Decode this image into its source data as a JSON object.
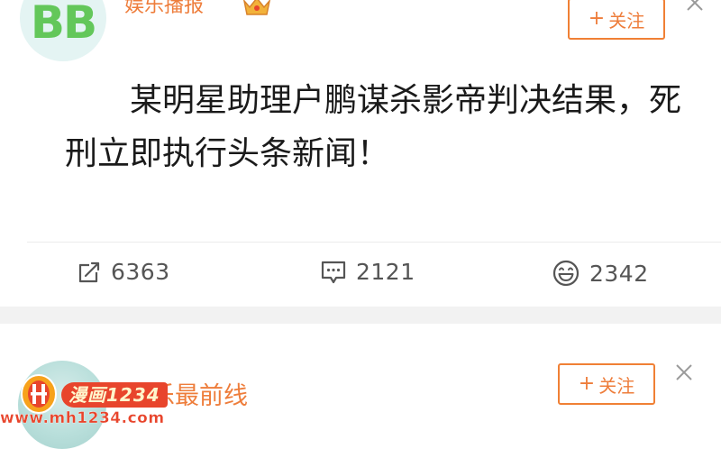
{
  "post1": {
    "avatar_text": "BB",
    "username": "娱乐播报",
    "badge_icon": "crown-badge-icon",
    "follow_label": "关注",
    "content": "某明星助理户鹏谋杀影帝判决结果，死刑立即执行头条新闻！",
    "actions": {
      "repost_count": "6363",
      "comment_count": "2121",
      "like_count": "2342"
    }
  },
  "post2": {
    "username": "娱乐最前线",
    "follow_label": "关注"
  },
  "watermark": {
    "banner": "漫画1234",
    "url": "www.mh1234.com"
  },
  "colors": {
    "accent": "#ee7d3b",
    "text": "#1a1a1a",
    "muted": "#555555",
    "separator": "#f2f2f2"
  }
}
